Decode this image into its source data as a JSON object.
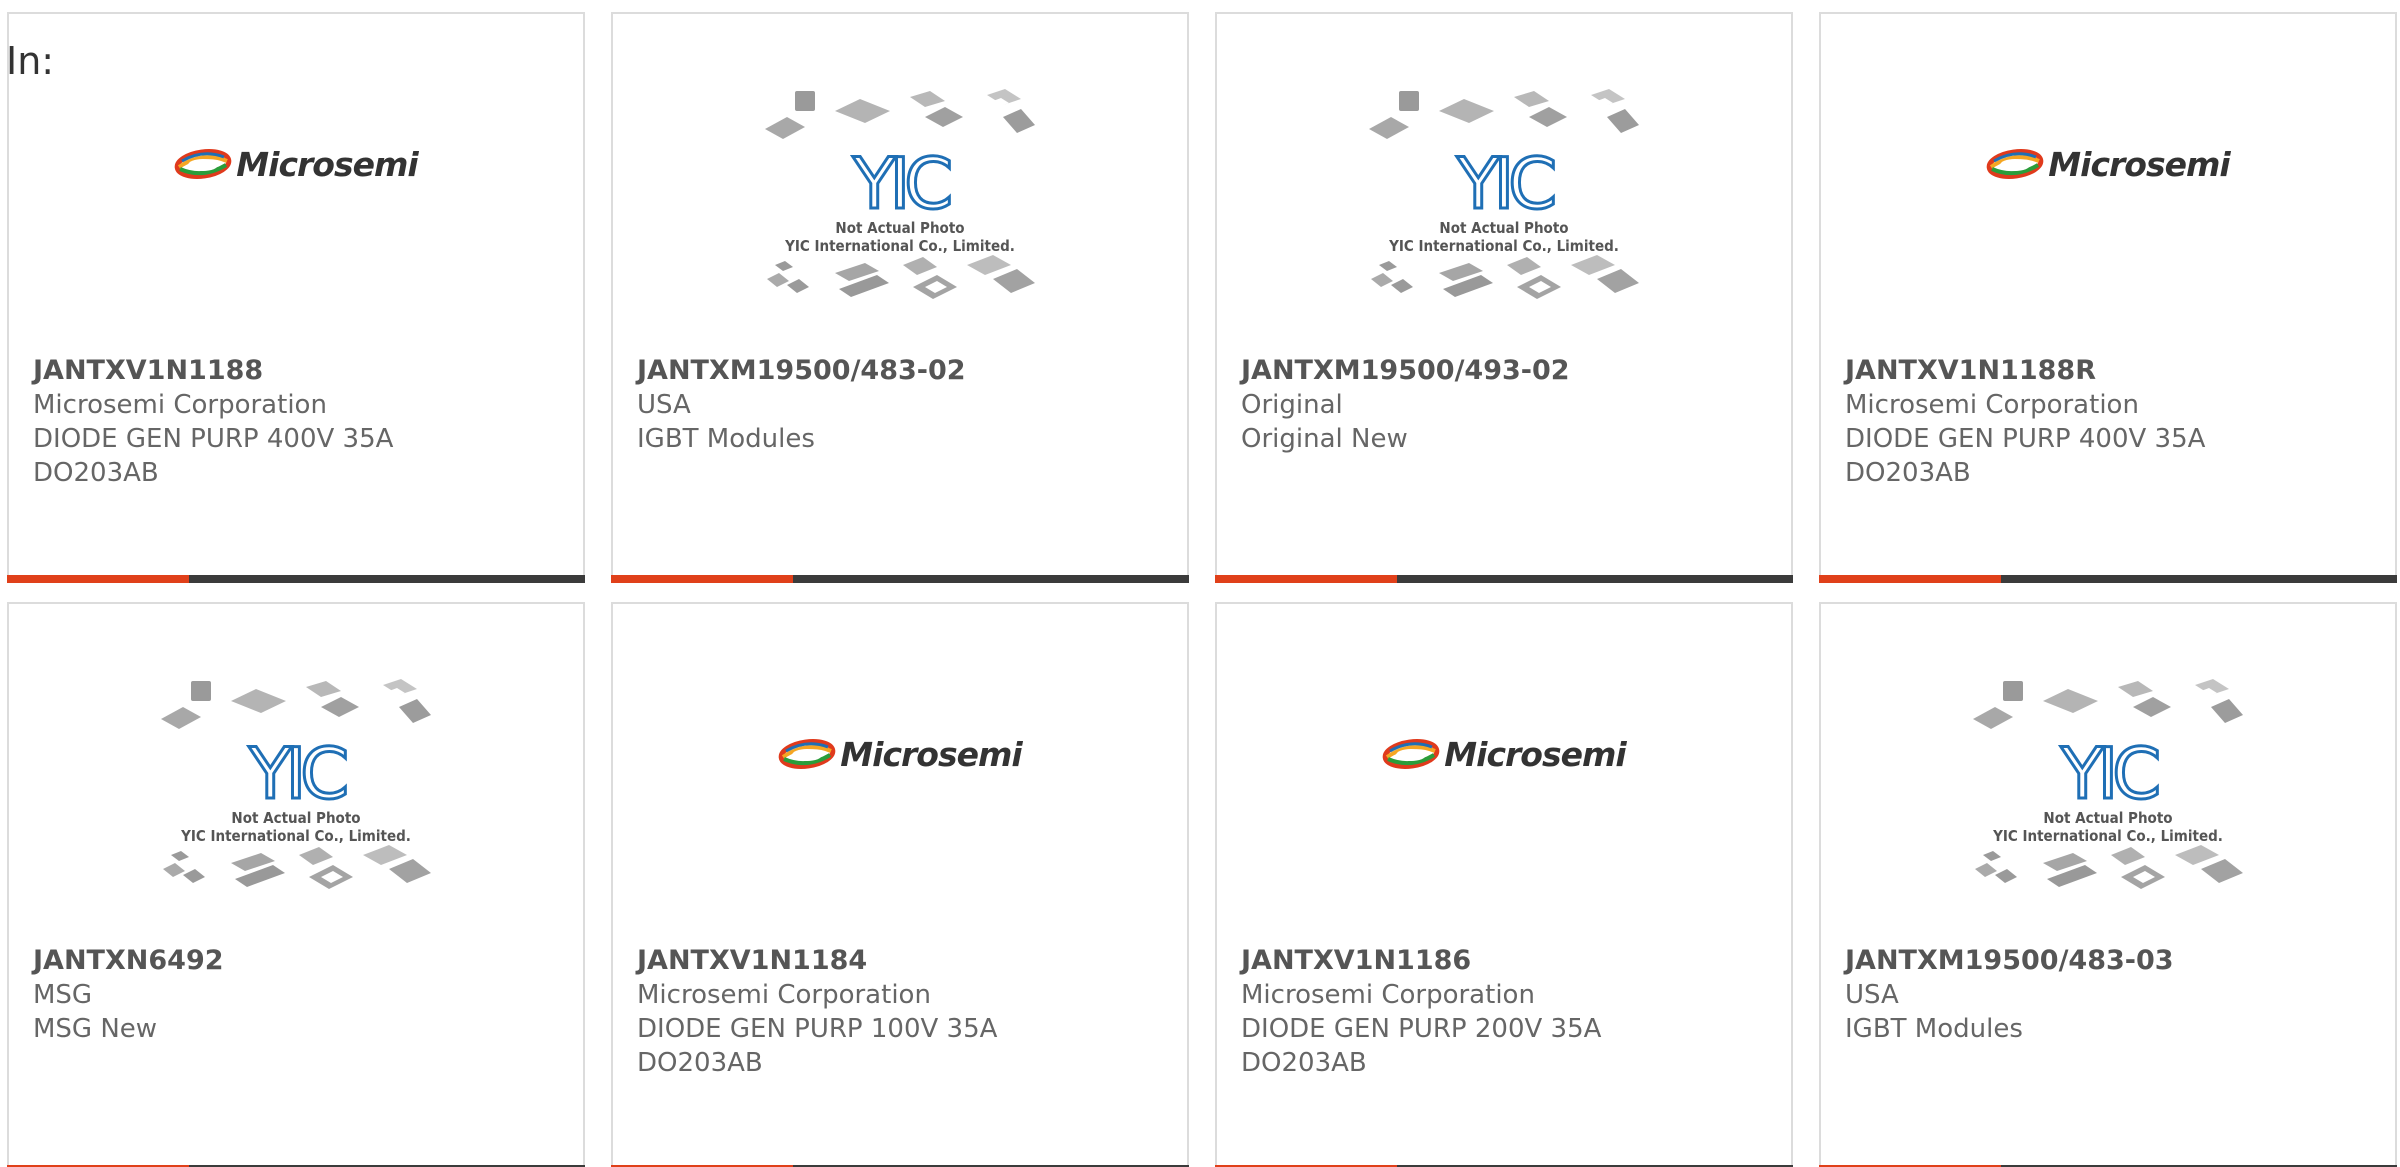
{
  "header": {
    "label": "In:"
  },
  "placeholder": {
    "brand": "YIC",
    "line1": "Not Actual Photo",
    "line2": "YIC International Co., Limited."
  },
  "logo": {
    "microsemi_text": "Microsemi"
  },
  "colors": {
    "accent": "#e0401a",
    "bar": "#3b3b3b",
    "border": "#dcdcdc",
    "yic_blue": "#1f6fb5"
  },
  "products": [
    {
      "part": "JANTXV1N1188",
      "lines": [
        "Microsemi Corporation",
        "DIODE GEN PURP 400V 35A",
        "DO203AB"
      ],
      "image": "microsemi-logo"
    },
    {
      "part": "JANTXM19500/483-02",
      "lines": [
        "USA",
        "IGBT Modules"
      ],
      "image": "yic-placeholder"
    },
    {
      "part": "JANTXM19500/493-02",
      "lines": [
        "Original",
        "Original New"
      ],
      "image": "yic-placeholder"
    },
    {
      "part": "JANTXV1N1188R",
      "lines": [
        "Microsemi Corporation",
        "DIODE GEN PURP 400V 35A",
        "DO203AB"
      ],
      "image": "microsemi-logo"
    },
    {
      "part": "JANTXN6492",
      "lines": [
        "MSG",
        "MSG New"
      ],
      "image": "yic-placeholder"
    },
    {
      "part": "JANTXV1N1184",
      "lines": [
        "Microsemi Corporation",
        "DIODE GEN PURP 100V 35A",
        "DO203AB"
      ],
      "image": "microsemi-logo"
    },
    {
      "part": "JANTXV1N1186",
      "lines": [
        "Microsemi Corporation",
        "DIODE GEN PURP 200V 35A",
        "DO203AB"
      ],
      "image": "microsemi-logo"
    },
    {
      "part": "JANTXM19500/483-03",
      "lines": [
        "USA",
        "IGBT Modules"
      ],
      "image": "yic-placeholder"
    }
  ]
}
